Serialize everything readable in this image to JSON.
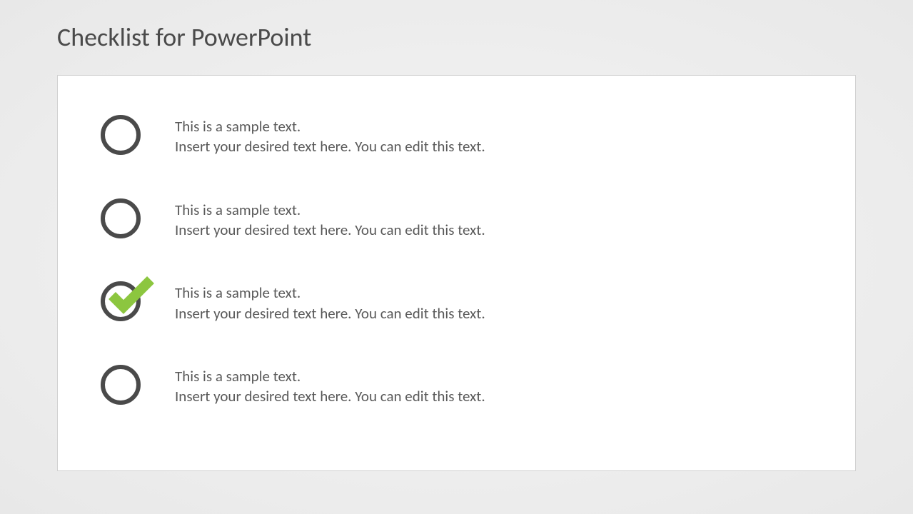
{
  "title": "Checklist for PowerPoint",
  "items": [
    {
      "checked": false,
      "line1": "This is a sample text.",
      "line2": "Insert your desired text here. You can edit this text."
    },
    {
      "checked": false,
      "line1": "This is a sample text.",
      "line2": "Insert your desired text here. You can edit this text."
    },
    {
      "checked": true,
      "line1": "This is a sample text.",
      "line2": "Insert your desired text here. You can edit this text."
    },
    {
      "checked": false,
      "line1": "This is a sample text.",
      "line2": "Insert your desired text here. You can edit this text."
    }
  ],
  "colors": {
    "checkmark": "#8cc63f"
  }
}
